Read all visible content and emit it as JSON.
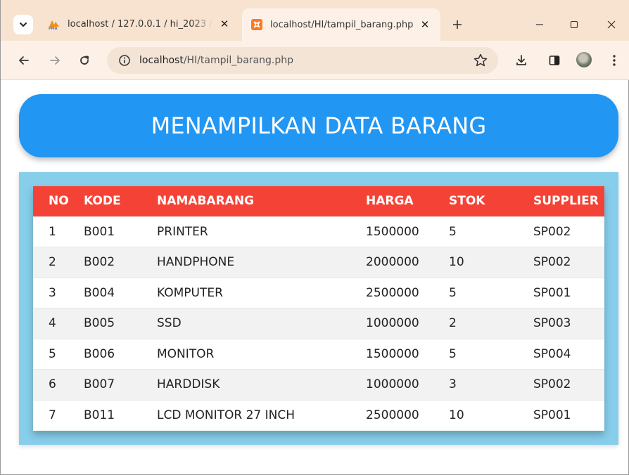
{
  "browser": {
    "tabs": [
      {
        "title": "localhost / 127.0.0.1 / hi_2023 / ",
        "active": false
      },
      {
        "title": "localhost/HI/tampil_barang.php",
        "active": true
      }
    ],
    "url_host": "localhost",
    "url_path": "/HI/tampil_barang.php",
    "icons": {
      "tab_menu": "chevron-down-icon",
      "new_tab": "plus-icon",
      "back": "arrow-left-icon",
      "forward": "arrow-right-icon",
      "reload": "reload-icon",
      "site_info": "info-icon",
      "bookmark": "star-icon",
      "download": "download-icon",
      "side_panel": "side-panel-icon",
      "menu": "kebab-menu-icon"
    }
  },
  "page": {
    "title": "MENAMPILKAN DATA BARANG",
    "colors": {
      "header_bg": "#2196f3",
      "table_frame_bg": "#87ceeb",
      "table_header_bg": "#f44336"
    },
    "table": {
      "columns": [
        "NO",
        "KODE",
        "NAMABARANG",
        "HARGA",
        "STOK",
        "SUPPLIER"
      ],
      "rows": [
        [
          "1",
          "B001",
          "PRINTER",
          "1500000",
          "5",
          "SP002"
        ],
        [
          "2",
          "B002",
          "HANDPHONE",
          "2000000",
          "10",
          "SP002"
        ],
        [
          "3",
          "B004",
          "KOMPUTER",
          "2500000",
          "5",
          "SP001"
        ],
        [
          "4",
          "B005",
          "SSD",
          "1000000",
          "2",
          "SP003"
        ],
        [
          "5",
          "B006",
          "MONITOR",
          "1500000",
          "5",
          "SP004"
        ],
        [
          "6",
          "B007",
          "HARDDISK",
          "1000000",
          "3",
          "SP002"
        ],
        [
          "7",
          "B011",
          "LCD MONITOR 27 INCH",
          "2500000",
          "10",
          "SP001"
        ]
      ]
    }
  }
}
